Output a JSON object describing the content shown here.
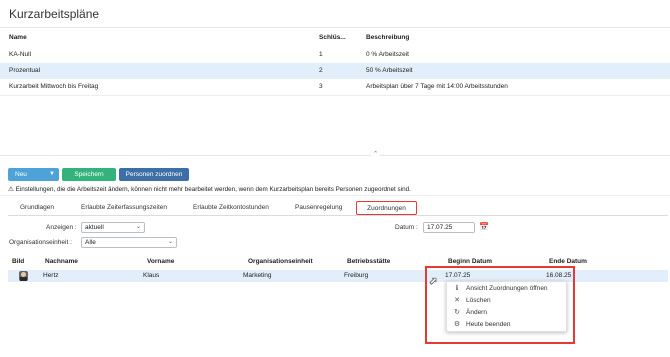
{
  "page": {
    "title": "Kurzarbeitspläne"
  },
  "plans_table": {
    "columns": [
      "Name",
      "Schlüs...",
      "Beschreibung"
    ],
    "rows": [
      {
        "name": "KA-Null",
        "key": "1",
        "desc": "0 % Arbeitszeit"
      },
      {
        "name": "Prozentual",
        "key": "2",
        "desc": "50 % Arbeitszeit"
      },
      {
        "name": "Kurzarbeit Mittwoch bis Freitag",
        "key": "3",
        "desc": "Arbeitsplan über 7 Tage mit 14:00 Arbeitsstunden"
      }
    ]
  },
  "toolbar": {
    "new_label": "Neu",
    "save_label": "Speichern",
    "assign_label": "Personen zuordnen"
  },
  "warning": {
    "icon": "warning-icon",
    "text": "Einstellungen, die die Arbeitszeit ändern, können nicht mehr bearbeitet werden, wenn dem Kurzarbeitsplan bereits Personen zugeordnet sind."
  },
  "tabs": [
    {
      "label": "Grundlagen"
    },
    {
      "label": "Erlaubte Zeiterfassungszeiten"
    },
    {
      "label": "Erlaubte Zeitkontostunden"
    },
    {
      "label": "Pausenregelung"
    },
    {
      "label": "Zuordnungen",
      "active": true
    }
  ],
  "filters": {
    "show_label": "Anzeigen :",
    "show_value": "aktuell",
    "org_label": "Organisationseinheit :",
    "org_value": "Alle",
    "date_label": "Datum :",
    "date_value": "17.07.25"
  },
  "assignments": {
    "columns": [
      "Bild",
      "Nachname",
      "Vorname",
      "Organisationseinheit",
      "Betriebsstätte",
      "Beginn Datum",
      "Ende Datum"
    ],
    "rows": [
      {
        "lastname": "Hertz",
        "firstname": "Klaus",
        "org": "Marketing",
        "site": "Freiburg",
        "begin": "17.07.25",
        "end": "16.08.25"
      }
    ]
  },
  "context_menu": {
    "items": [
      {
        "label": "Ansicht Zuordnungen öffnen",
        "icon": "info-icon"
      },
      {
        "label": "Löschen",
        "icon": "close-icon"
      },
      {
        "label": "Ändern",
        "icon": "refresh-icon"
      },
      {
        "label": "Heute beenden",
        "icon": "gear-icon"
      }
    ]
  },
  "colors": {
    "accent_blue": "#4da3d8",
    "save_green": "#34b27c",
    "assign_blue": "#3d6fa7",
    "highlight_red": "#e53935",
    "selected_row": "#e2eef9"
  }
}
